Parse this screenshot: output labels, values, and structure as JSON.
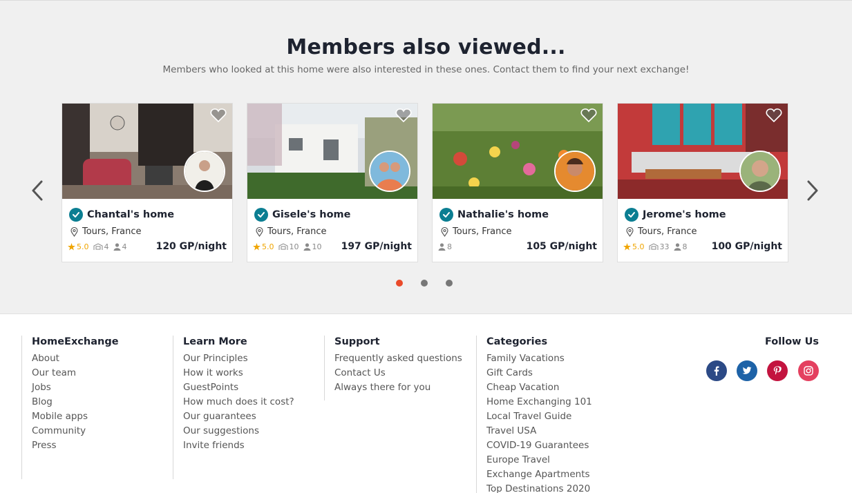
{
  "section": {
    "title": "Members also viewed...",
    "subtitle": "Members who looked at this home were also interested in these ones. Contact them to find your next exchange!"
  },
  "cards": [
    {
      "title": "Chantal's home",
      "location": "Tours, France",
      "rating": "5.0",
      "bedrooms": "4",
      "guests": "4",
      "price": "120 GP/night"
    },
    {
      "title": "Gisele's home",
      "location": "Tours, France",
      "rating": "5.0",
      "bedrooms": "10",
      "guests": "10",
      "price": "197 GP/night"
    },
    {
      "title": "Nathalie's home",
      "location": "Tours, France",
      "guests": "8",
      "price": "105 GP/night"
    },
    {
      "title": "Jerome's home",
      "location": "Tours, France",
      "rating": "5.0",
      "bedrooms": "33",
      "guests": "8",
      "price": "100 GP/night"
    }
  ],
  "carousel": {
    "active_dot": 1,
    "dots": 3
  },
  "footer": {
    "col1": {
      "title": "HomeExchange",
      "links": [
        "About",
        "Our team",
        "Jobs",
        "Blog",
        "Mobile apps",
        "Community",
        "Press"
      ]
    },
    "col2": {
      "title": "Learn More",
      "links": [
        "Our Principles",
        "How it works",
        "GuestPoints",
        "How much does it cost?",
        "Our guarantees",
        "Our suggestions",
        "Invite friends"
      ]
    },
    "col3": {
      "title": "Support",
      "links": [
        "Frequently asked questions",
        "Contact Us",
        "Always there for you"
      ]
    },
    "col4": {
      "title": "Categories",
      "links": [
        "Family Vacations",
        "Gift Cards",
        "Cheap Vacation",
        "Home Exchanging 101",
        "Local Travel Guide",
        "Travel USA",
        "COVID-19 Guarantees",
        "Europe Travel",
        "Exchange Apartments",
        "Top Destinations 2020"
      ]
    },
    "follow_title": "Follow Us",
    "social": [
      {
        "name": "facebook-icon",
        "glyph": "f",
        "color": "#2c4a86"
      },
      {
        "name": "twitter-icon",
        "glyph": "t",
        "color": "#1d62a7"
      },
      {
        "name": "pinterest-icon",
        "glyph": "P",
        "color": "#c3143f"
      },
      {
        "name": "instagram-icon",
        "glyph": "◎",
        "color": "#e4405f"
      }
    ]
  },
  "colors": {
    "accent": "#ea4a2a",
    "verified": "#0b7e92",
    "rating": "#f0a500"
  }
}
